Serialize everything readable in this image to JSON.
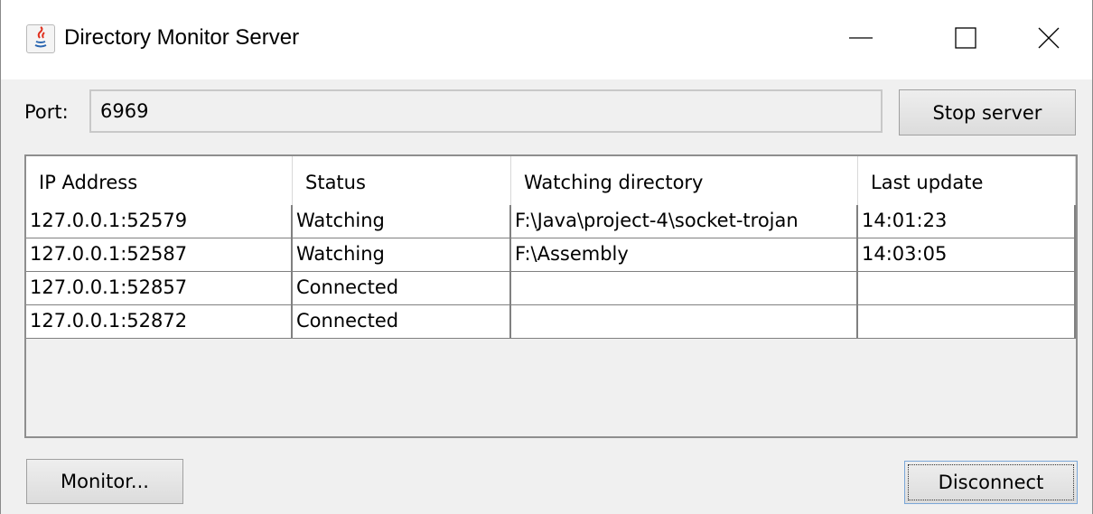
{
  "window": {
    "title": "Directory Monitor Server",
    "icons": {
      "app": "java-icon",
      "minimize": "minimize-icon",
      "maximize": "maximize-icon",
      "close": "close-icon"
    }
  },
  "port": {
    "label": "Port:",
    "value": "6969"
  },
  "buttons": {
    "stop_server": "Stop server",
    "monitor": "Monitor...",
    "disconnect": "Disconnect"
  },
  "table": {
    "columns": [
      "IP Address",
      "Status",
      "Watching directory",
      "Last update"
    ],
    "rows": [
      [
        "127.0.0.1:52579",
        "Watching",
        "F:\\Java\\project-4\\socket-trojan",
        "14:01:23"
      ],
      [
        "127.0.0.1:52587",
        "Watching",
        "F:\\Assembly",
        "14:03:05"
      ],
      [
        "127.0.0.1:52857",
        "Connected",
        "",
        ""
      ],
      [
        "127.0.0.1:52872",
        "Connected",
        "",
        ""
      ]
    ]
  },
  "colors": {
    "window_bg": "#f0f0f0",
    "title_bg": "#ffffff",
    "focus_border": "#7aa7d8"
  }
}
